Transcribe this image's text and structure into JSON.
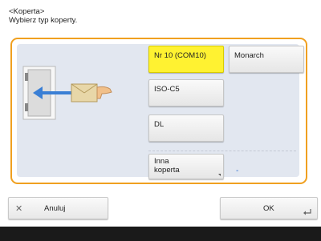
{
  "header": {
    "line1": "<Koperta>",
    "line2": "Wybierz typ koperty."
  },
  "options": {
    "nr10": "Nr 10 (COM10)",
    "monarch": "Monarch",
    "iso_c5": "ISO-C5",
    "dl": "DL",
    "other_line1": "Inna",
    "other_line2": "koperta",
    "other_value": "-"
  },
  "footer": {
    "cancel_label": "Anuluj",
    "ok_label": "OK"
  },
  "colors": {
    "selected": "#fff231",
    "panel_border": "#f0a020",
    "arrow": "#3a7fd5"
  }
}
